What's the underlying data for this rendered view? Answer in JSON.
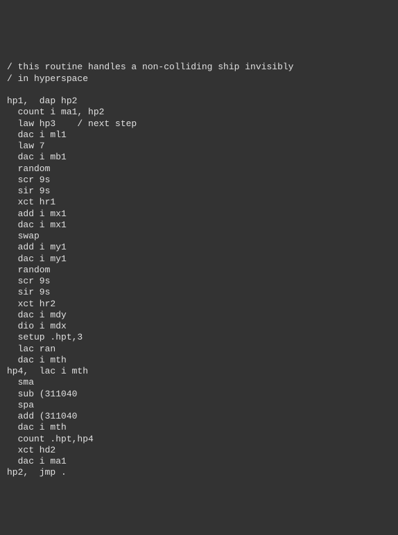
{
  "code": {
    "comment1": "/ this routine handles a non-colliding ship invisibly",
    "comment2": "/ in hyperspace",
    "blank1": "",
    "l01": "hp1,  dap hp2",
    "l02": "  count i ma1, hp2",
    "l03": "  law hp3    / next step",
    "l04": "  dac i ml1",
    "l05": "  law 7",
    "l06": "  dac i mb1",
    "l07": "  random",
    "l08": "  scr 9s",
    "l09": "  sir 9s",
    "l10": "  xct hr1",
    "l11": "  add i mx1",
    "l12": "  dac i mx1",
    "l13": "  swap",
    "l14": "  add i my1",
    "l15": "  dac i my1",
    "l16": "  random",
    "l17": "  scr 9s",
    "l18": "  sir 9s",
    "l19": "  xct hr2",
    "l20": "  dac i mdy",
    "l21": "  dio i mdx",
    "l22": "  setup .hpt,3",
    "l23": "  lac ran",
    "l24": "  dac i mth",
    "l25": "hp4,  lac i mth",
    "l26": "  sma",
    "l27": "  sub (311040",
    "l28": "  spa",
    "l29": "  add (311040",
    "l30": "  dac i mth",
    "l31": "  count .hpt,hp4",
    "l32": "  xct hd2",
    "l33": "  dac i ma1",
    "l34": "hp2,  jmp ."
  }
}
